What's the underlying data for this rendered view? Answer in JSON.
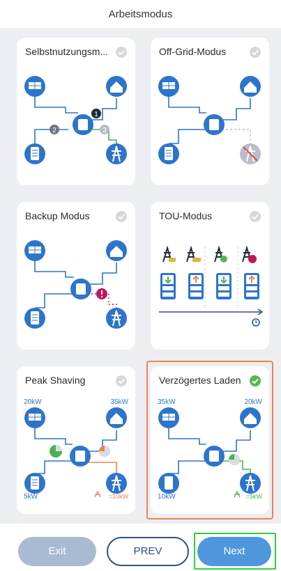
{
  "header": {
    "title": "Arbeitsmodus"
  },
  "modes": [
    {
      "name": "Selbstnutzungsm...",
      "selected": false
    },
    {
      "name": "Off-Grid-Modus",
      "selected": false
    },
    {
      "name": "Backup Modus",
      "selected": false
    },
    {
      "name": "TOU-Modus",
      "selected": false
    },
    {
      "name": "Peak Shaving",
      "selected": false,
      "labels": {
        "pv": "20kW",
        "home": "35kW",
        "battery": "5kW",
        "grid": "=10kW"
      }
    },
    {
      "name": "Verzögertes Laden",
      "selected": true,
      "labels": {
        "pv": "35kW",
        "home": "20kW",
        "battery": "10kW",
        "grid": "=5kW"
      }
    }
  ],
  "step_numbers": {
    "one": "1",
    "two": "2",
    "three": "3"
  },
  "footer": {
    "exit_label": "Exit",
    "prev_label": "PREV",
    "next_label": "Next"
  },
  "colors": {
    "accent_blue": "#2d74cc",
    "check_green": "#55b94a",
    "selected_border": "#f0814e",
    "next_highlight": "#28d43b"
  }
}
